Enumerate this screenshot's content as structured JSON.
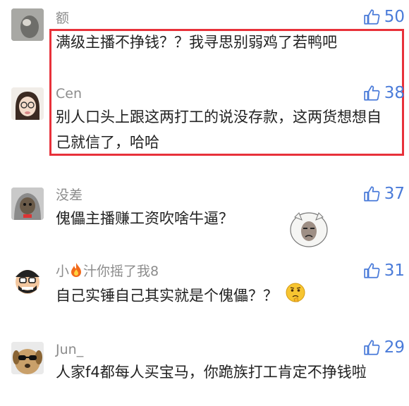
{
  "comments": [
    {
      "username": "额",
      "text": "满级主播不挣钱？？我寻思别弱鸡了若鸭吧",
      "likes": "50",
      "avatar_icon": "gray-animal-avatar-icon"
    },
    {
      "username": "Cen",
      "text": "别人口头上跟这两打工的说没存款，这两货想想自己就信了，哈哈",
      "likes": "38",
      "avatar_icon": "girl-with-glasses-avatar-icon"
    },
    {
      "username": "没差",
      "text": "傀儡主播赚工资吹啥牛逼？",
      "likes": "37",
      "avatar_icon": "cat-in-hood-avatar-icon"
    },
    {
      "username_prefix": "小",
      "username_suffix": "汁你摇了我8",
      "text": "自己实锤自己其实就是个傀儡？？",
      "likes": "31",
      "avatar_icon": "cartoon-face-avatar-icon"
    },
    {
      "username": "Jun_",
      "text": "人家f4都每人买宝马，你跪族打工肯定不挣钱啦",
      "likes": "29",
      "avatar_icon": "dog-with-sunglasses-avatar-icon"
    }
  ],
  "colors": {
    "highlight": "#e8313a",
    "like": "#4a7bd9",
    "username": "#8c8c8c",
    "text": "#222222"
  },
  "icons": {
    "like": "thumbs-up-icon",
    "fire": "fire-icon",
    "sticker": "meme-face-sticker-icon",
    "emoji": "thinking-emoji-icon"
  }
}
